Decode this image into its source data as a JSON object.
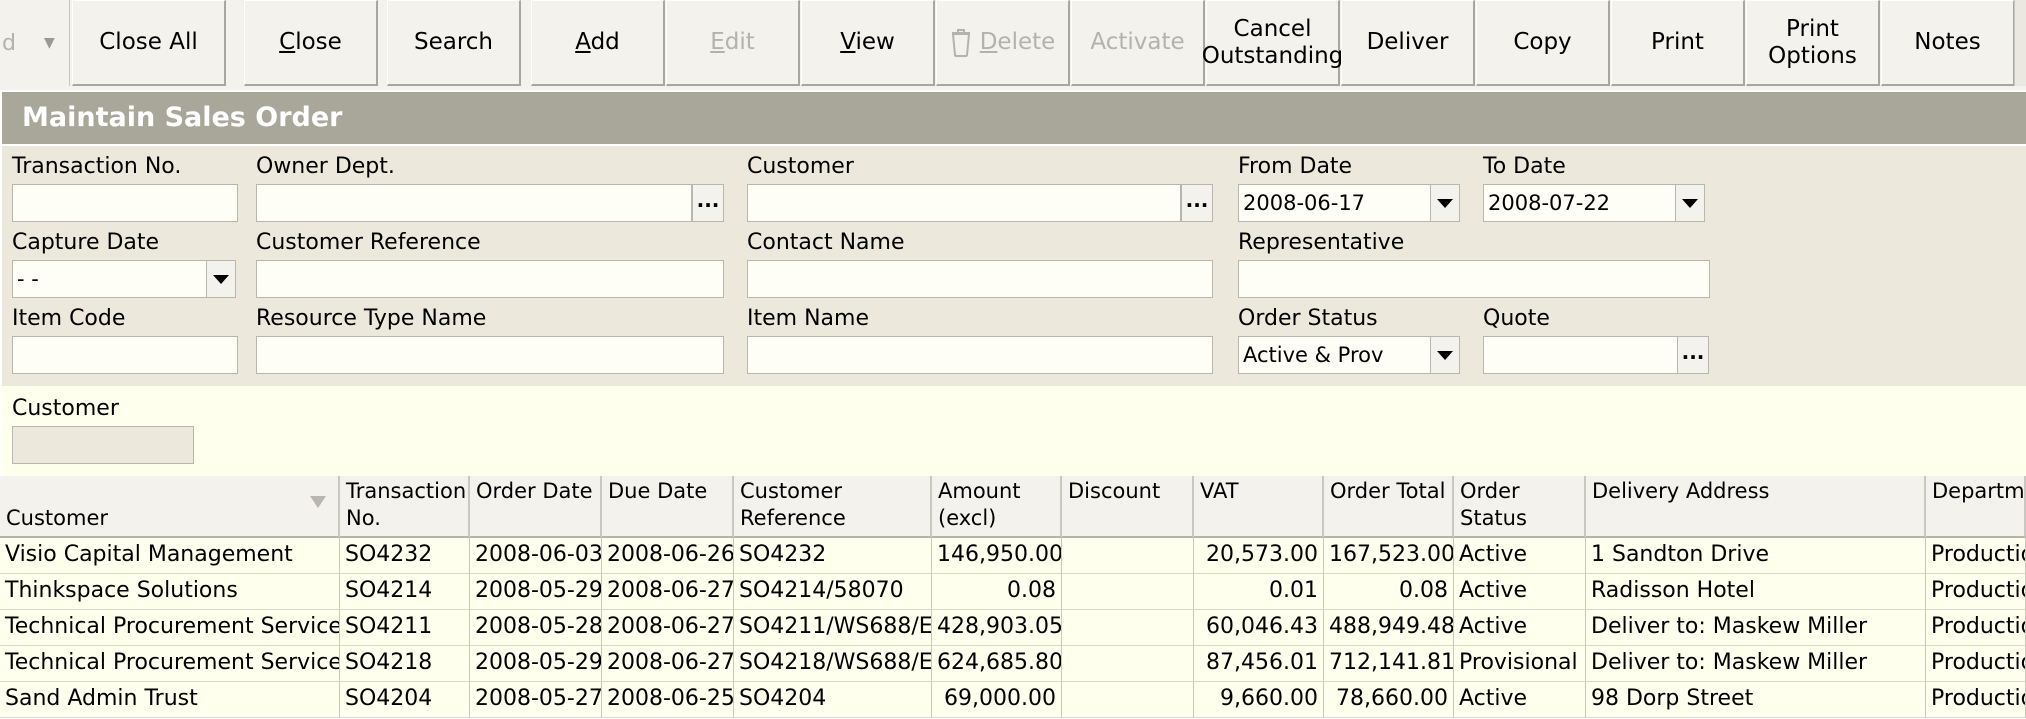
{
  "toolbar": {
    "dropdown_text": "d",
    "buttons": {
      "close_all": "Close All",
      "close": "Close",
      "search": "Search",
      "add": "Add",
      "edit": "Edit",
      "view": "View",
      "delete": "Delete",
      "activate": "Activate",
      "cancel_outstanding": "Cancel\nOutstanding",
      "deliver": "Deliver",
      "copy": "Copy",
      "print": "Print",
      "print_options": "Print\nOptions",
      "notes": "Notes"
    }
  },
  "title": "Maintain Sales Order",
  "filters": {
    "transaction_no": {
      "label": "Transaction No.",
      "value": ""
    },
    "owner_dept": {
      "label": "Owner Dept.",
      "value": ""
    },
    "customer": {
      "label": "Customer",
      "value": ""
    },
    "from_date": {
      "label": "From Date",
      "value": "2008-06-17"
    },
    "to_date": {
      "label": "To Date",
      "value": "2008-07-22"
    },
    "capture_date": {
      "label": "Capture Date",
      "value": " -  -"
    },
    "customer_reference": {
      "label": "Customer Reference",
      "value": ""
    },
    "contact_name": {
      "label": "Contact Name",
      "value": ""
    },
    "representative": {
      "label": "Representative",
      "value": ""
    },
    "item_code": {
      "label": "Item Code",
      "value": ""
    },
    "resource_type_name": {
      "label": "Resource Type Name",
      "value": ""
    },
    "item_name": {
      "label": "Item Name",
      "value": ""
    },
    "order_status": {
      "label": "Order Status",
      "value": "Active & Prov"
    },
    "quote": {
      "label": "Quote",
      "value": ""
    },
    "ellipsis": "..."
  },
  "customer_panel": {
    "label": "Customer",
    "value": ""
  },
  "grid": {
    "headers": {
      "customer": "Customer",
      "transaction_no": "Transaction\nNo.",
      "order_date": "Order Date",
      "due_date": "Due Date",
      "customer_reference": "Customer\nReference",
      "amount_excl": "Amount\n(excl)",
      "discount": "Discount",
      "vat": "VAT",
      "order_total": "Order Total",
      "order_status": "Order\nStatus",
      "delivery_address": "Delivery Address",
      "department": "Departme"
    },
    "rows": [
      {
        "customer": "Visio Capital Management",
        "transaction_no": "SO4232",
        "order_date": "2008-06-03",
        "due_date": "2008-06-26",
        "customer_reference": "SO4232",
        "amount_excl": "146,950.00",
        "discount": "",
        "vat": "20,573.00",
        "order_total": "167,523.00",
        "order_status": "Active",
        "delivery_address": "1 Sandton Drive",
        "department": "Productio"
      },
      {
        "customer": "Thinkspace Solutions",
        "transaction_no": "SO4214",
        "order_date": "2008-05-29",
        "due_date": "2008-06-27",
        "customer_reference": "SO4214/58070",
        "amount_excl": "0.08",
        "discount": "",
        "vat": "0.01",
        "order_total": "0.08",
        "order_status": "Active",
        "delivery_address": "Radisson Hotel",
        "department": "Productio"
      },
      {
        "customer": "Technical Procurement Services",
        "transaction_no": "SO4211",
        "order_date": "2008-05-28",
        "due_date": "2008-06-27",
        "customer_reference": "SO4211/WS688/E",
        "amount_excl": "428,903.05",
        "discount": "",
        "vat": "60,046.43",
        "order_total": "488,949.48",
        "order_status": "Active",
        "delivery_address": "Deliver to:  Maskew Miller",
        "department": "Productio"
      },
      {
        "customer": "Technical Procurement Services",
        "transaction_no": "SO4218",
        "order_date": "2008-05-29",
        "due_date": "2008-06-27",
        "customer_reference": "SO4218/WS688/E",
        "amount_excl": "624,685.80",
        "discount": "",
        "vat": "87,456.01",
        "order_total": "712,141.81",
        "order_status": "Provisional",
        "delivery_address": "Deliver to:  Maskew Miller",
        "department": "Productio"
      },
      {
        "customer": "Sand Admin Trust",
        "transaction_no": "SO4204",
        "order_date": "2008-05-27",
        "due_date": "2008-06-25",
        "customer_reference": "SO4204",
        "amount_excl": "69,000.00",
        "discount": "",
        "vat": "9,660.00",
        "order_total": "78,660.00",
        "order_status": "Active",
        "delivery_address": "98 Dorp Street",
        "department": "Productio"
      }
    ]
  }
}
